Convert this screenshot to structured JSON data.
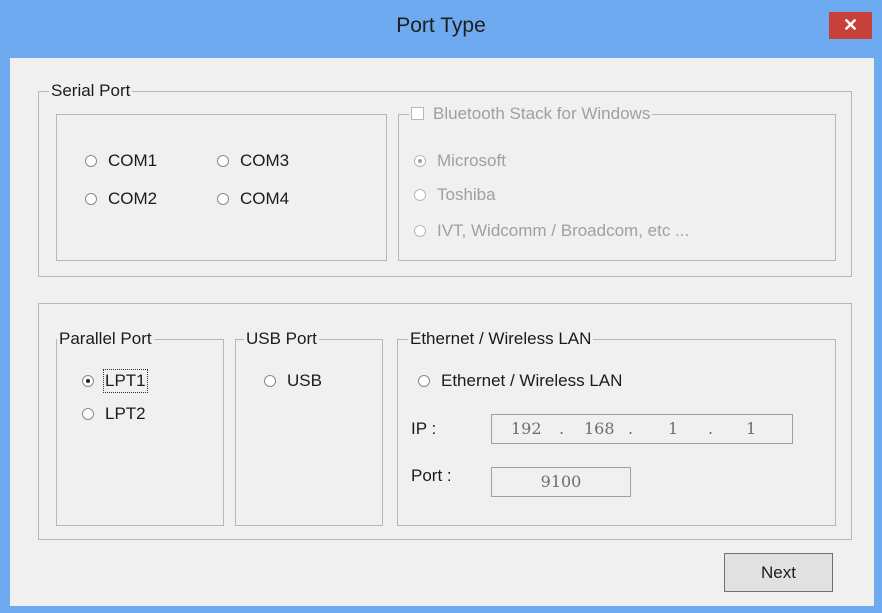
{
  "window": {
    "title": "Port Type",
    "close_glyph": "✕"
  },
  "serial": {
    "legend": "Serial Port",
    "ports": [
      "COM1",
      "COM3",
      "COM2",
      "COM4"
    ],
    "bluetooth": {
      "legend": "Bluetooth Stack for Windows",
      "checked": false,
      "options": [
        "Microsoft",
        "Toshiba",
        "IVT, Widcomm / Broadcom, etc ..."
      ],
      "selected": "Microsoft"
    }
  },
  "parallel": {
    "legend": "Parallel Port",
    "ports": [
      "LPT1",
      "LPT2"
    ],
    "selected": "LPT1"
  },
  "usb": {
    "legend": "USB Port",
    "option": "USB"
  },
  "ethernet": {
    "legend": "Ethernet  / Wireless LAN",
    "option": "Ethernet  / Wireless LAN",
    "ip_label": "IP :",
    "ip": [
      "192",
      "168",
      "1",
      "1"
    ],
    "port_label": "Port :",
    "port": "9100"
  },
  "buttons": {
    "next": "Next"
  },
  "colors": {
    "titlebar": "#6eaaf0",
    "close": "#c7413a",
    "dialog": "#f0f0f0"
  }
}
